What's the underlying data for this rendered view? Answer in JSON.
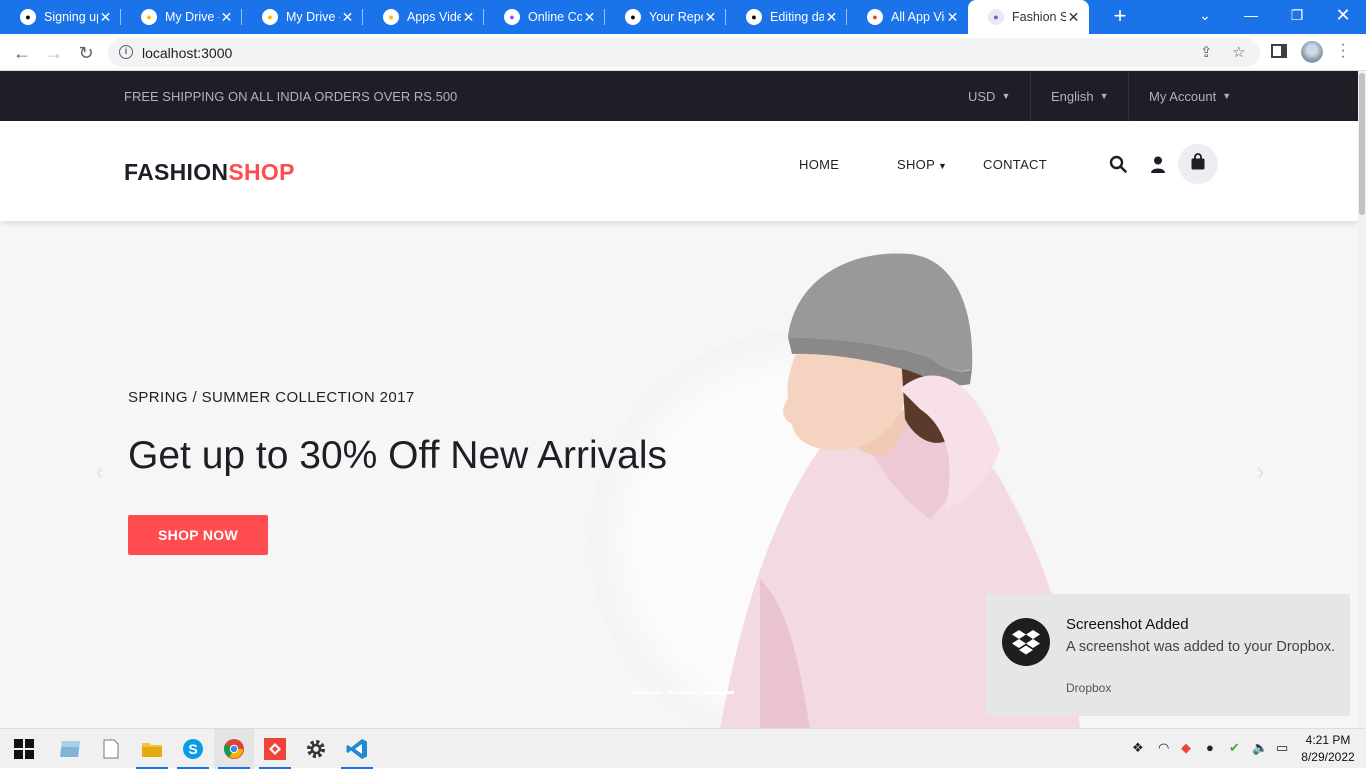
{
  "browser": {
    "tabs": [
      {
        "title": "Signing up",
        "icon": "github-icon",
        "color": "#000000"
      },
      {
        "title": "My Drive -",
        "icon": "google-drive-icon",
        "color": "#fbbc04"
      },
      {
        "title": "My Drive -",
        "icon": "google-drive-icon",
        "color": "#fbbc04"
      },
      {
        "title": "Apps Video",
        "icon": "google-drive-icon",
        "color": "#fbbc04"
      },
      {
        "title": "Online Con",
        "icon": "converter-icon",
        "color": "#7e5bef"
      },
      {
        "title": "Your Repo",
        "icon": "github-icon",
        "color": "#000000"
      },
      {
        "title": "Editing dat",
        "icon": "github-icon",
        "color": "#000000"
      },
      {
        "title": "All App Vid",
        "icon": "gmail-icon",
        "color": "#ea4335"
      },
      {
        "title": "Fashion Sh",
        "icon": "shopping-bag-icon",
        "color": "#7e57c2",
        "active": true
      }
    ],
    "url": "localhost:3000"
  },
  "topbar": {
    "message": "FREE SHIPPING ON ALL INDIA ORDERS OVER RS.500",
    "currency": "USD",
    "language": "English",
    "account": "My Account"
  },
  "header": {
    "logo_part1": "FASHION",
    "logo_part2": "SHOP",
    "nav": {
      "home": "HOME",
      "shop": "SHOP",
      "contact": "CONTACT"
    }
  },
  "hero": {
    "subtitle": "SPRING / SUMMER COLLECTION 2017",
    "title": "Get up to 30% Off New Arrivals",
    "button": "SHOP NOW"
  },
  "toast": {
    "title": "Screenshot Added",
    "body": "A screenshot was added to your Dropbox.",
    "source": "Dropbox"
  },
  "taskbar": {
    "time": "4:21 PM",
    "date": "8/29/2022"
  },
  "colors": {
    "accent": "#fe4c50",
    "dark": "#1e1e27",
    "chrome_blue": "#1a73e8"
  }
}
